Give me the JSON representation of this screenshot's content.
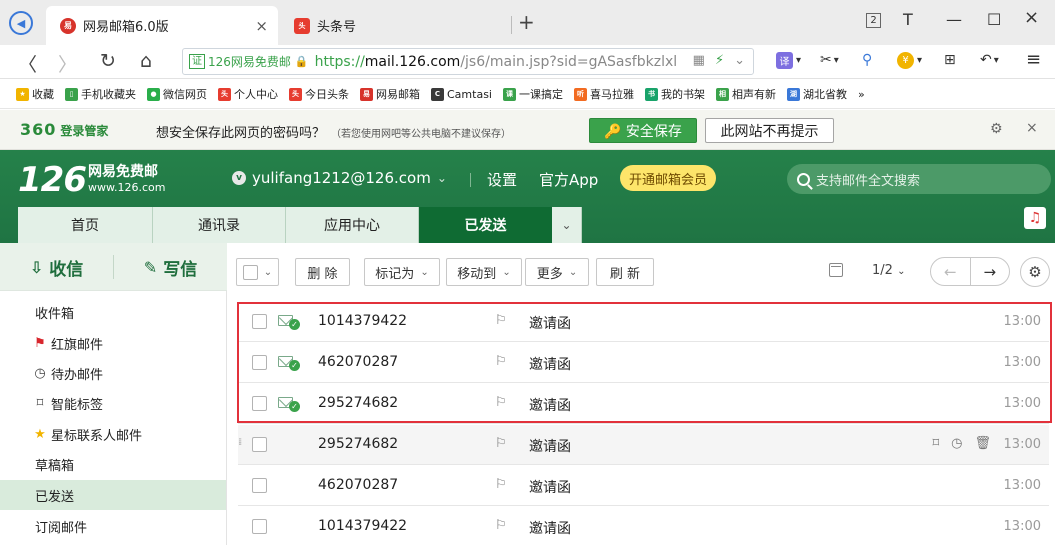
{
  "browser": {
    "tabs": [
      {
        "title": "网易邮箱6.0版",
        "close": "×"
      },
      {
        "title": "头条号"
      }
    ],
    "new_tab": "+",
    "win_restore": "2",
    "win_skin": "T",
    "win_min": "—",
    "win_max": "☐",
    "win_close": "×",
    "nav": {
      "back": "〈",
      "forward": "〉",
      "reload": "↻",
      "home": "⌂"
    },
    "cert_badge": "证",
    "cert_label": "126网易免费邮",
    "url_https": "https://",
    "url_host": "mail.126.com",
    "url_rest": "/js6/main.jsp?sid=gASasfbkzlxl",
    "toolbar": {
      "translate": "译",
      "scissors": "✂",
      "search": "⚲",
      "coin": "¥",
      "grid": "⊞",
      "undo": "↶",
      "menu": "≡"
    }
  },
  "bookmarks": [
    {
      "label": "收藏",
      "color": "#f1b400",
      "glyph": "★"
    },
    {
      "label": "手机收藏夹",
      "color": "#3aa24b",
      "glyph": "▯"
    },
    {
      "label": "微信网页",
      "color": "#2aae4b",
      "glyph": "●"
    },
    {
      "label": "个人中心",
      "color": "#e63c2f",
      "glyph": "头"
    },
    {
      "label": "今日头条",
      "color": "#e63c2f",
      "glyph": "头"
    },
    {
      "label": "网易邮箱",
      "color": "#d7332b",
      "glyph": "易"
    },
    {
      "label": "Camtasi",
      "color": "#3a3a3a",
      "glyph": "C"
    },
    {
      "label": "一课搞定",
      "color": "#3aa24b",
      "glyph": "课"
    },
    {
      "label": "喜马拉雅",
      "color": "#f26b21",
      "glyph": "听"
    },
    {
      "label": "我的书架",
      "color": "#19a36a",
      "glyph": "书"
    },
    {
      "label": "相声有新",
      "color": "#3aa24b",
      "glyph": "相"
    },
    {
      "label": "湖北省教",
      "color": "#3a78d8",
      "glyph": "湖"
    },
    {
      "label": "»",
      "color": "",
      "glyph": ""
    }
  ],
  "bar360": {
    "logo": "360",
    "logo_sub": "登录管家",
    "question": "想安全保存此网页的密码吗？",
    "hint": "（若您使用网吧等公共电脑不建议保存）",
    "save_btn": "🔑 安全保存",
    "never_btn": "此网站不再提示",
    "settings": "⚙",
    "close": "×"
  },
  "mail_header": {
    "logo_num": "126",
    "logo_name": "网易免费邮",
    "logo_url": "www.126.com",
    "account_badge": "v",
    "account": "yulifang1212@126.com",
    "settings": "设置",
    "app": "官方App",
    "vip_btn": "开通邮箱会员",
    "search_placeholder": "支持邮件全文搜索",
    "tabs": [
      {
        "label": "首页"
      },
      {
        "label": "通讯录"
      },
      {
        "label": "应用中心"
      },
      {
        "label": "已发送"
      }
    ],
    "more_tab": "⌄",
    "music": "♫"
  },
  "sidebar": {
    "receive": "收信",
    "write": "写信",
    "folders": [
      {
        "label": "收件箱",
        "icon": ""
      },
      {
        "label": "红旗邮件",
        "icon": "⚑"
      },
      {
        "label": "待办邮件",
        "icon": "◷"
      },
      {
        "label": "智能标签",
        "icon": "⌑"
      },
      {
        "label": "星标联系人邮件",
        "icon": "★"
      },
      {
        "label": "草稿箱",
        "icon": ""
      },
      {
        "label": "已发送",
        "icon": ""
      },
      {
        "label": "订阅邮件",
        "icon": ""
      }
    ]
  },
  "toolbar": {
    "delete": "删 除",
    "mark_as": "标记为",
    "move_to": "移动到",
    "more": "更多",
    "refresh": "刷 新",
    "page": "1/2",
    "prev": "←",
    "next": "→",
    "gear": "⚙"
  },
  "mails": [
    {
      "to": "1014379422",
      "subject": "邀请函",
      "time": "13:00"
    },
    {
      "to": "462070287",
      "subject": "邀请函",
      "time": "13:00"
    },
    {
      "to": "295274682",
      "subject": "邀请函",
      "time": "13:00"
    },
    {
      "to": "295274682",
      "subject": "邀请函",
      "time": "13:00"
    },
    {
      "to": "462070287",
      "subject": "邀请函",
      "time": "13:00"
    },
    {
      "to": "1014379422",
      "subject": "邀请函",
      "time": "13:00"
    }
  ]
}
